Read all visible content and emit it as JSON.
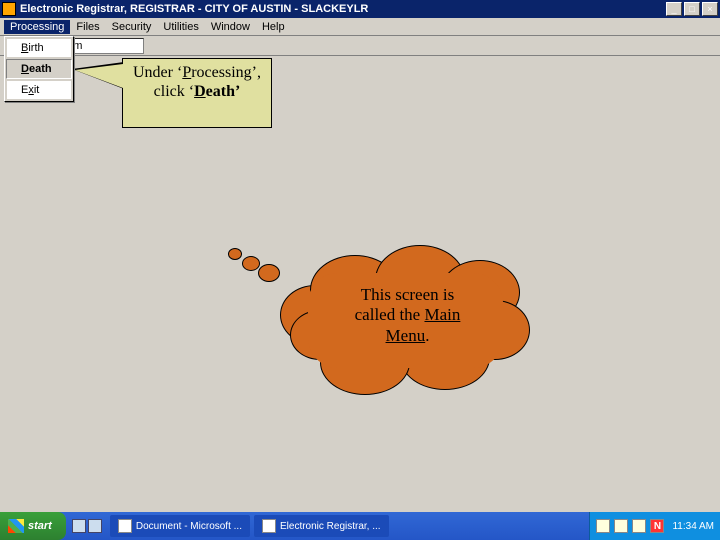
{
  "window": {
    "title": "Electronic Registrar, REGISTRAR - CITY OF AUSTIN - SLACKEYLR"
  },
  "win_controls": {
    "min": "_",
    "max": "□",
    "close": "×"
  },
  "menubar": {
    "items": [
      "Processing",
      "Files",
      "Security",
      "Utilities",
      "Window",
      "Help"
    ]
  },
  "urlbar": {
    "value": "enesisinfo.com"
  },
  "dropdown": {
    "birth_pre": "",
    "birth_u": "B",
    "birth_post": "irth",
    "death_pre": "",
    "death_u": "D",
    "death_post": "eath",
    "exit_pre": "E",
    "exit_u": "x",
    "exit_post": "it"
  },
  "callout": {
    "line1_pre": "Under ‘",
    "line1_u": "P",
    "line1_post": "rocessing’,",
    "line2_pre": "click ‘",
    "line2_u": "D",
    "line2_post": "eath’"
  },
  "cloud": {
    "line1": "This screen is",
    "line2_pre": "called the ",
    "line2_u": "Main",
    "line3_u": "Menu",
    "line3_post": "."
  },
  "taskbar": {
    "start": "start",
    "tasks": [
      "Document - Microsoft ...",
      "Electronic Registrar, ..."
    ],
    "clock": "11:34 AM"
  }
}
